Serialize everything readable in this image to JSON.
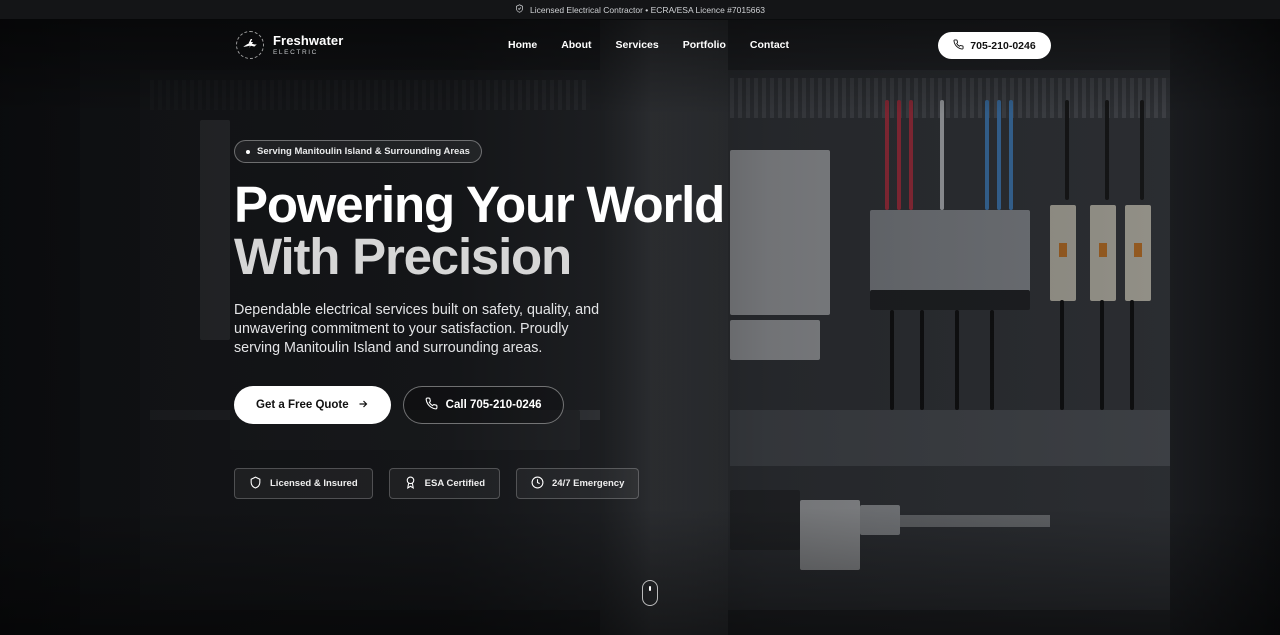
{
  "topbar": {
    "text": "Licensed Electrical Contractor • ECRA/ESA Licence #7015663",
    "icon": "shield-check-icon"
  },
  "header": {
    "logo": {
      "name": "Freshwater",
      "tagline": "ELECTRIC",
      "icon": "logo-emblem-icon"
    },
    "nav": [
      {
        "label": "Home"
      },
      {
        "label": "About"
      },
      {
        "label": "Services"
      },
      {
        "label": "Portfolio"
      },
      {
        "label": "Contact"
      }
    ],
    "phone": {
      "label": "705-210-0246",
      "icon": "phone-icon"
    }
  },
  "hero": {
    "pill": "Serving Manitoulin Island & Surrounding Areas",
    "title_line1": "Powering Your World",
    "title_line2": "With Precision",
    "lead": "Dependable electrical services built on safety, quality, and unwavering commitment to your satisfaction. Proudly serving Manitoulin Island and surrounding areas.",
    "cta_primary": {
      "label": "Get a Free Quote",
      "icon": "arrow-right-icon"
    },
    "cta_secondary": {
      "label": "Call 705-210-0246",
      "icon": "phone-icon"
    },
    "badges": [
      {
        "label": "Licensed & Insured",
        "icon": "shield-icon"
      },
      {
        "label": "ESA Certified",
        "icon": "award-icon"
      },
      {
        "label": "24/7 Emergency",
        "icon": "clock-icon"
      }
    ]
  },
  "scroll_indicator": {
    "icon": "mouse-scroll-icon"
  },
  "colors": {
    "background": "#15171a",
    "text": "#ffffff",
    "button": "#ffffff",
    "button_text": "#111111"
  }
}
